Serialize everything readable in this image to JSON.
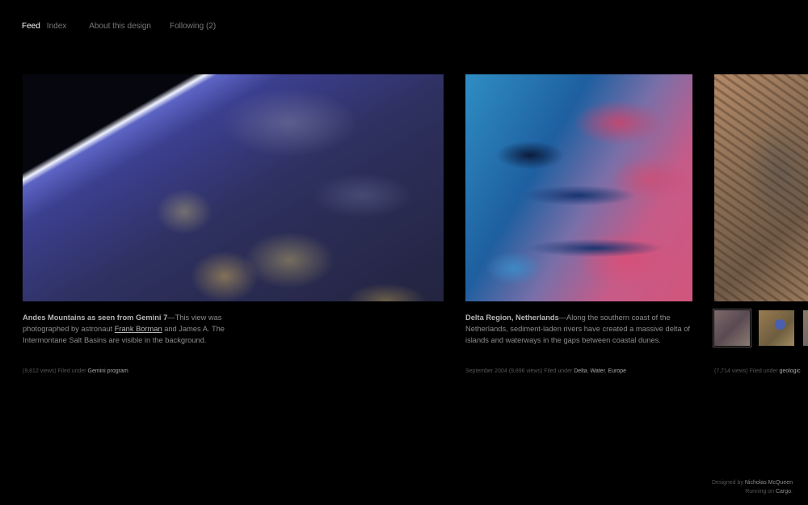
{
  "nav": {
    "feed": "Feed",
    "index": "Index",
    "about": "About this design",
    "following": "Following (2)"
  },
  "posts": [
    {
      "title": "Andes Mountains as seen from Gemini 7",
      "caption_part1": "—This view was photographed by astronaut ",
      "caption_link": "Frank Borman",
      "caption_part2": " and James A. The Intermontane Salt Basins are visible in the background.",
      "meta_prefix": "(9,812 views) Filed under ",
      "tags": [
        "Gemini program"
      ]
    },
    {
      "title": "Delta Region, Netherlands",
      "caption_part1": "—Along the southern coast of the Netherlands, sediment-laden rivers have created a massive delta of islands and waterways in the gaps between coastal dunes.",
      "meta_prefix": "September 2004 (9,896 views) Filed under ",
      "tags": [
        "Delta",
        "Water",
        "Europe"
      ],
      "tag_sep": ", "
    },
    {
      "meta_prefix": "(7,714 views) Filed under ",
      "tags": [
        "geologic"
      ]
    }
  ],
  "footer": {
    "designed_by_prefix": "Designed by ",
    "designer": "Nicholas McQueen",
    "running_on_prefix": "Running on ",
    "platform": "Cargo",
    "period": "."
  }
}
